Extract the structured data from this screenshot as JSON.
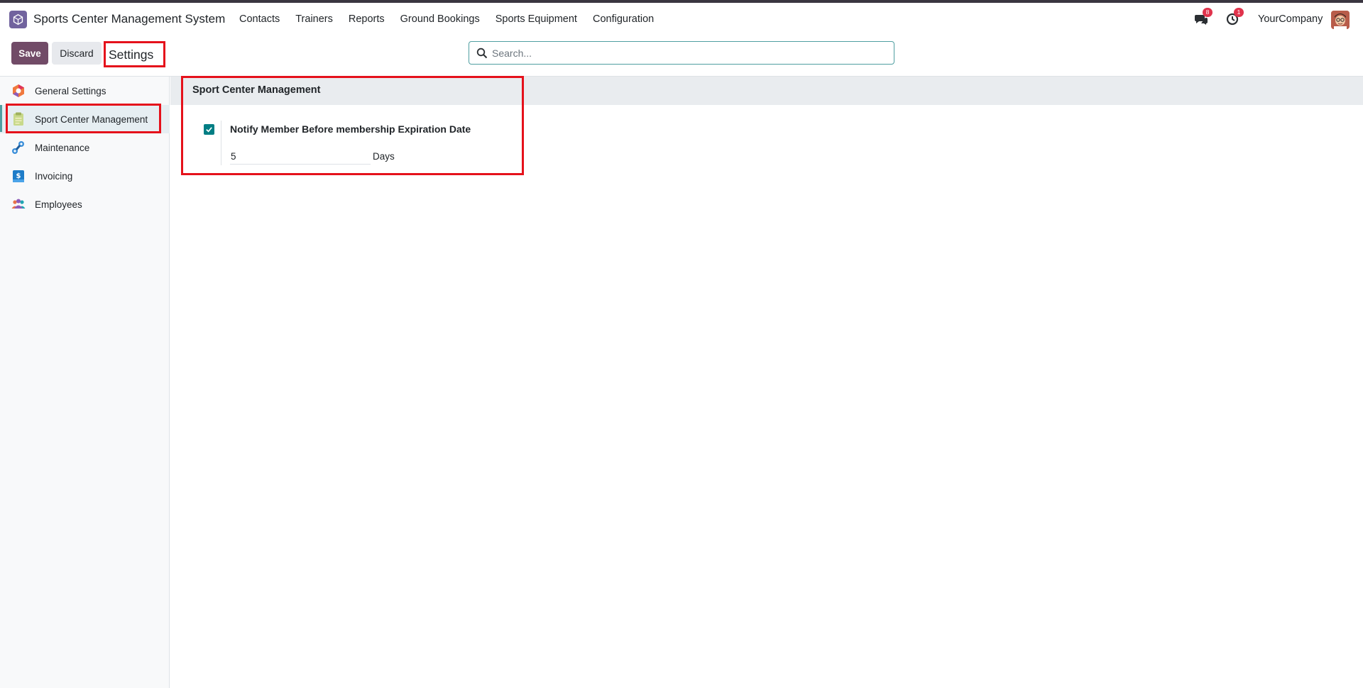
{
  "app": {
    "title": "Sports Center Management System"
  },
  "menu": {
    "items": [
      {
        "label": "Contacts"
      },
      {
        "label": "Trainers"
      },
      {
        "label": "Reports"
      },
      {
        "label": "Ground Bookings"
      },
      {
        "label": "Sports Equipment"
      },
      {
        "label": "Configuration"
      }
    ]
  },
  "systray": {
    "messages_count": "8",
    "activities_count": "1",
    "company": "YourCompany"
  },
  "control": {
    "save_label": "Save",
    "discard_label": "Discard",
    "breadcrumb": "Settings",
    "search_placeholder": "Search..."
  },
  "sidebar": {
    "items": [
      {
        "label": "General Settings",
        "icon": "general-settings-icon"
      },
      {
        "label": "Sport Center Management",
        "icon": "sport-center-icon"
      },
      {
        "label": "Maintenance",
        "icon": "maintenance-icon"
      },
      {
        "label": "Invoicing",
        "icon": "invoicing-icon"
      },
      {
        "label": "Employees",
        "icon": "employees-icon"
      }
    ],
    "active_index": 1
  },
  "section": {
    "title": "Sport Center Management",
    "setting": {
      "label": "Notify Member Before membership Expiration Date",
      "checked": true,
      "value": "5",
      "unit": "Days"
    }
  },
  "colors": {
    "primary": "#714b67",
    "accent": "#017e84",
    "highlight": "#e5111b",
    "badge": "#e0334c"
  }
}
